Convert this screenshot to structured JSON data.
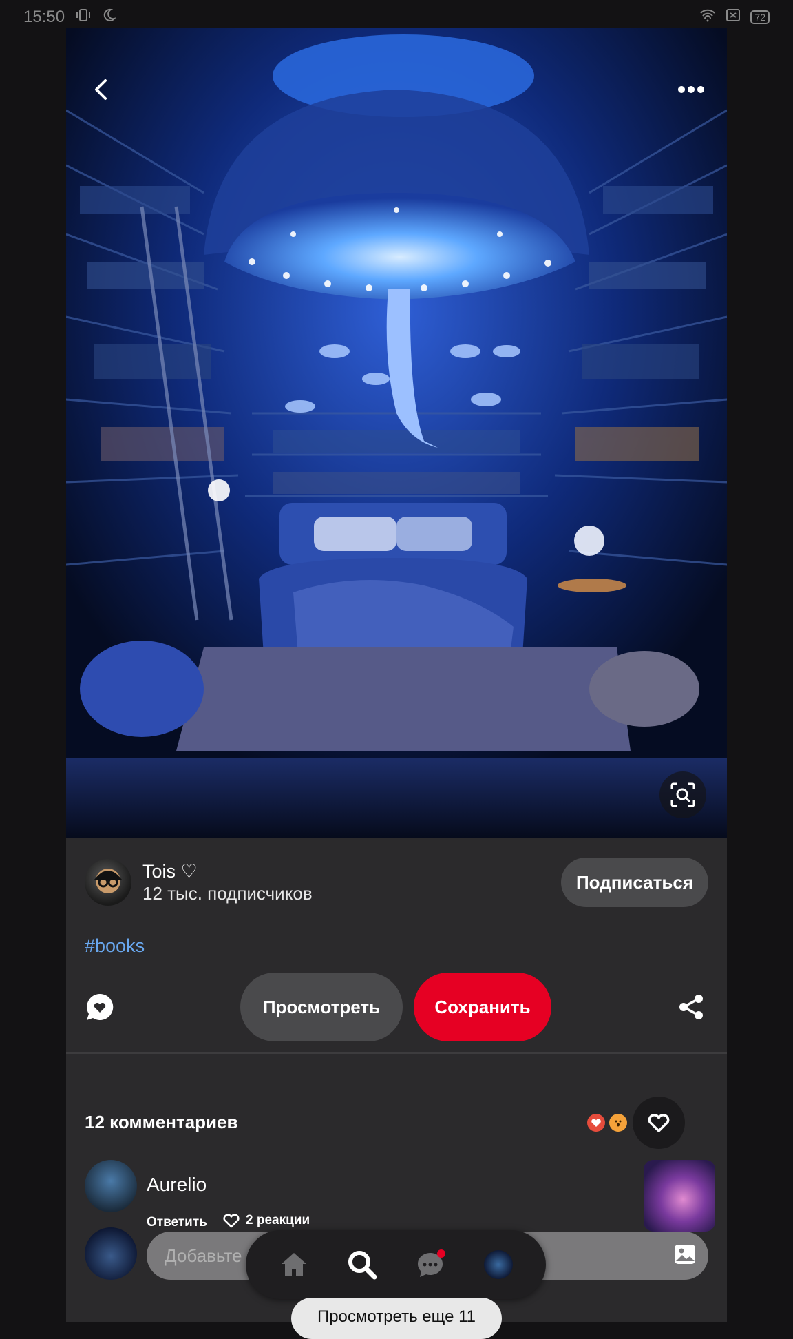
{
  "status_bar": {
    "time": "15:50",
    "battery": "72",
    "icons": [
      "vibrate-icon",
      "moon-icon",
      "wifi-icon",
      "no-sim-icon",
      "battery-icon"
    ]
  },
  "pin": {
    "image_alt": "glowing mushroom library bedroom",
    "creator_name": "Tois ♡",
    "creator_followers": "12 тыс. подписчиков",
    "follow_label": "Подписаться",
    "hashtag": "#books",
    "view_label": "Просмотреть",
    "save_label": "Сохранить"
  },
  "comments": {
    "count_label": "12 комментариев",
    "reaction_count": "17",
    "items": [
      {
        "author": "Aurelio",
        "reply_label": "Ответить",
        "likes_label": "2 реакции"
      }
    ],
    "compose_placeholder": "Добавьте комментарий",
    "more_label": "Просмотреть еще 11"
  },
  "bottom_nav": {
    "items": [
      "home-icon",
      "search-icon",
      "messages-icon",
      "profile-avatar"
    ]
  },
  "colors": {
    "save_red": "#e60023",
    "hashtag_blue": "#69a7ee",
    "panel": "#2b2a2c"
  }
}
